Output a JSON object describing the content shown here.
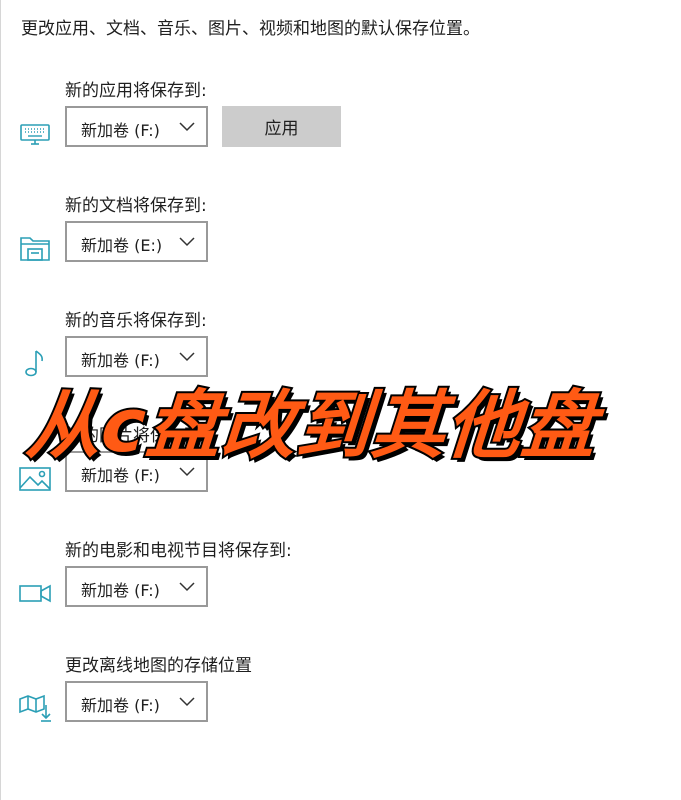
{
  "header": {
    "text": "更改应用、文档、音乐、图片、视频和地图的默认保存位置。"
  },
  "sections": [
    {
      "id": "apps",
      "label": "新的应用将保存到:",
      "icon": "monitor-keyboard-icon",
      "value": "新加卷 (F:)",
      "has_apply": true
    },
    {
      "id": "documents",
      "label": "新的文档将保存到:",
      "icon": "folder-drive-icon",
      "value": "新加卷 (E:)",
      "has_apply": false
    },
    {
      "id": "music",
      "label": "新的音乐将保存到:",
      "icon": "music-note-icon",
      "value": "新加卷 (F:)",
      "has_apply": false
    },
    {
      "id": "pictures",
      "label": "新的图片将保存到:",
      "icon": "picture-icon",
      "value": "新加卷 (F:)",
      "has_apply": false
    },
    {
      "id": "movies",
      "label": "新的电影和电视节目将保存到:",
      "icon": "video-camera-icon",
      "value": "新加卷 (F:)",
      "has_apply": false
    },
    {
      "id": "maps",
      "label": "更改离线地图的存储位置",
      "icon": "map-download-icon",
      "value": "新加卷 (F:)",
      "has_apply": false
    }
  ],
  "apply_button": {
    "label": "应用"
  },
  "overlay": {
    "text": "从c盘改到其他盘"
  },
  "colors": {
    "icon": "#2b9fb6",
    "overlay_fill": "#ff5a14",
    "overlay_stroke": "#000000",
    "button_bg": "#cccccc",
    "dropdown_border": "#999999"
  }
}
